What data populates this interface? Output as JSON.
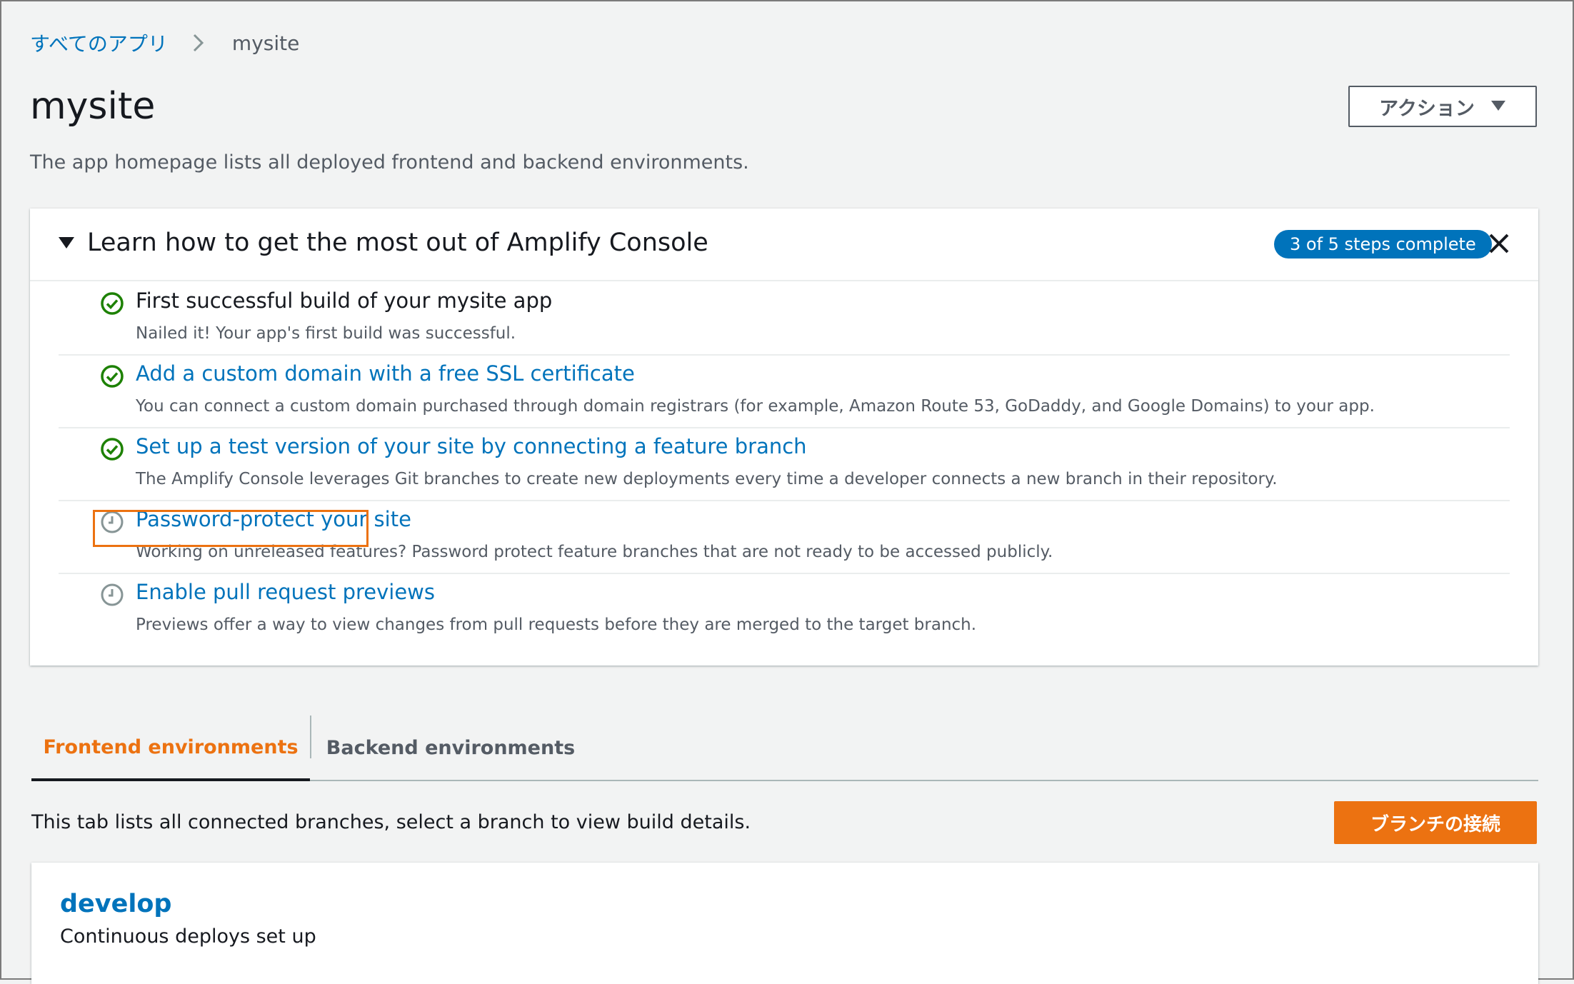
{
  "breadcrumb": {
    "root": "すべてのアプリ",
    "current": "mysite"
  },
  "header": {
    "title": "mysite",
    "description": "The app homepage lists all deployed frontend and backend environments.",
    "action_label": "アクション"
  },
  "learn_panel": {
    "title": "Learn how to get the most out of Amplify Console",
    "badge": "3 of 5 steps complete",
    "steps": [
      {
        "title": "First successful build of your mysite app",
        "description": "Nailed it! Your app's first build was successful.",
        "status": "complete"
      },
      {
        "title": "Add a custom domain with a free SSL certificate",
        "description": "You can connect a custom domain purchased through domain registrars (for example, Amazon Route 53, GoDaddy, and Google Domains) to your app.",
        "status": "complete"
      },
      {
        "title": "Set up a test version of your site by connecting a feature branch",
        "description": "The Amplify Console leverages Git branches to create new deployments every time a developer connects a new branch in their repository.",
        "status": "complete"
      },
      {
        "title": "Password-protect your site",
        "description": "Working on unreleased features? Password protect feature branches that are not ready to be accessed publicly.",
        "status": "pending"
      },
      {
        "title": "Enable pull request previews",
        "description": "Previews offer a way to view changes from pull requests before they are merged to the target branch.",
        "status": "pending"
      }
    ]
  },
  "tabs": [
    {
      "label": "Frontend environments",
      "active": true
    },
    {
      "label": "Backend environments",
      "active": false
    }
  ],
  "frontend": {
    "description": "This tab lists all connected branches, select a branch to view build details.",
    "connect_branch_label": "ブランチの接続",
    "branches": [
      {
        "name": "develop",
        "status": "Continuous deploys set up"
      }
    ]
  },
  "colors": {
    "link": "#0073bb",
    "accent": "#ec7211",
    "success": "#1d8102",
    "pending": "#879596"
  },
  "icons": {
    "breadcrumb_separator": "chevron-right-icon",
    "action_caret": "caret-down-icon",
    "panel_toggle": "caret-down-icon",
    "close": "close-icon",
    "complete": "check-circle-icon",
    "pending": "clock-icon"
  }
}
